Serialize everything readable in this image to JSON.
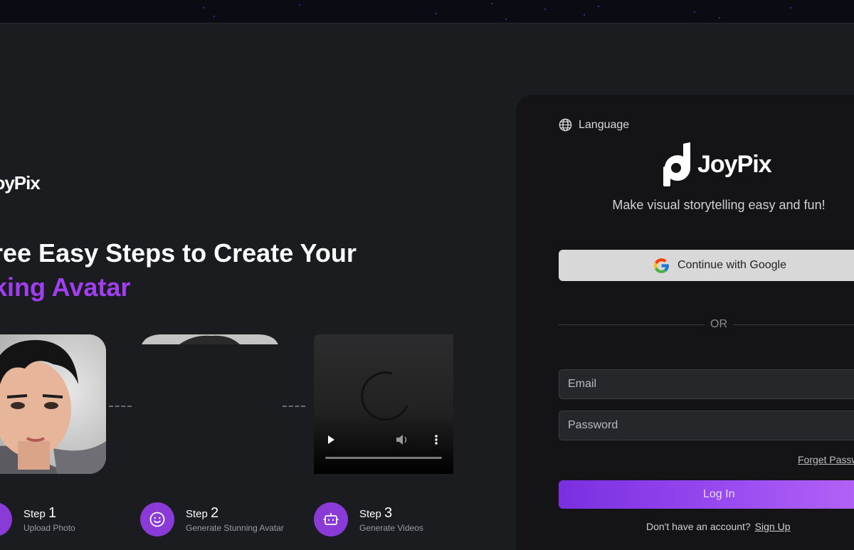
{
  "left": {
    "brand": "JoyPix",
    "headline_line1": "ree Easy Steps to Create Your",
    "headline_line2": "king Avatar",
    "steps": [
      {
        "label": "Step",
        "number": "1",
        "sub": "Upload Photo"
      },
      {
        "label": "Step",
        "number": "2",
        "sub": "Generate Stunning Avatar"
      },
      {
        "label": "Step",
        "number": "3",
        "sub": "Generate Videos"
      }
    ]
  },
  "login": {
    "language_label": "Language",
    "logo_text": "JoyPix",
    "tagline": "Make visual storytelling easy and fun!",
    "google_label": "Continue with Google",
    "or_label": "OR",
    "email_placeholder": "Email",
    "password_placeholder": "Password",
    "forgot_label": "Forget Passw",
    "login_label": "Log In",
    "no_account_text": "Don't have an account?",
    "signup_label": "Sign Up"
  },
  "colors": {
    "accent": "#a13ef0",
    "step_icon": "#8a3ad6",
    "background": "#1b1c20",
    "panel": "#141416"
  },
  "icons": [
    "globe-icon",
    "google-icon",
    "smile-icon",
    "robot-icon",
    "upload-icon",
    "play-icon",
    "volume-icon",
    "more-icon",
    "loading-spinner-icon"
  ]
}
